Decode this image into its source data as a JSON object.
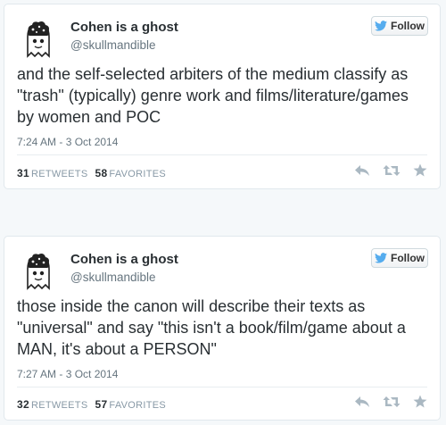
{
  "colors": {
    "page_bg": "#f5f8fa",
    "card_bg": "#ffffff",
    "text": "#292f33",
    "muted": "#66757f",
    "bird_blue": "#55acee",
    "action_gray": "#aab8c2"
  },
  "tweets": [
    {
      "author_name": "Cohen is a ghost",
      "author_handle": "@skullmandible",
      "follow_label": "Follow",
      "text": "and the self-selected arbiters of the medium classify as \"trash\" (typically) genre work and films/literature/games by women and POC",
      "time": "7:24 AM - 3 Oct 2014",
      "retweets_count": "31",
      "retweets_label": "RETWEETS",
      "favorites_count": "58",
      "favorites_label": "FAVORITES",
      "icons": [
        "ghost-avatar",
        "bird-icon",
        "reply-icon",
        "retweet-icon",
        "favorite-icon"
      ]
    },
    {
      "author_name": "Cohen is a ghost",
      "author_handle": "@skullmandible",
      "follow_label": "Follow",
      "text": "those inside the canon will describe their texts as \"universal\" and say \"this isn't a book/film/game about a MAN, it's about a PERSON\"",
      "time": "7:27 AM - 3 Oct 2014",
      "retweets_count": "32",
      "retweets_label": "RETWEETS",
      "favorites_count": "57",
      "favorites_label": "FAVORITES",
      "icons": [
        "ghost-avatar",
        "bird-icon",
        "reply-icon",
        "retweet-icon",
        "favorite-icon"
      ]
    }
  ]
}
